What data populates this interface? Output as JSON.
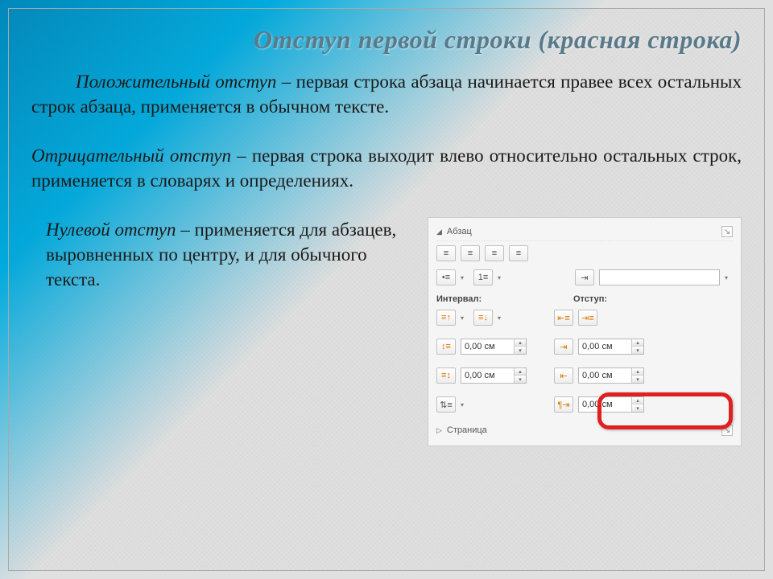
{
  "title": "Отступ первой строки (красная строка)",
  "para1_lead": "Положительный отступ",
  "para1_rest": " – первая строка абзаца начинается правее всех остальных строк абзаца, применяется в обычном тексте.",
  "para2_lead": "Отрицательный отступ",
  "para2_rest": " – первая строка выходит влево относительно остальных строк, применяется в словарях и определениях.",
  "para3_lead": "Нулевой отступ",
  "para3_rest": " – применяется для абзацев, выровненных по центру, и для обычного текста.",
  "panel": {
    "section_abzats": "Абзац",
    "label_interval": "Интервал:",
    "label_otstup": "Отступ:",
    "val_zero": "0,00 см",
    "section_page": "Страница"
  }
}
